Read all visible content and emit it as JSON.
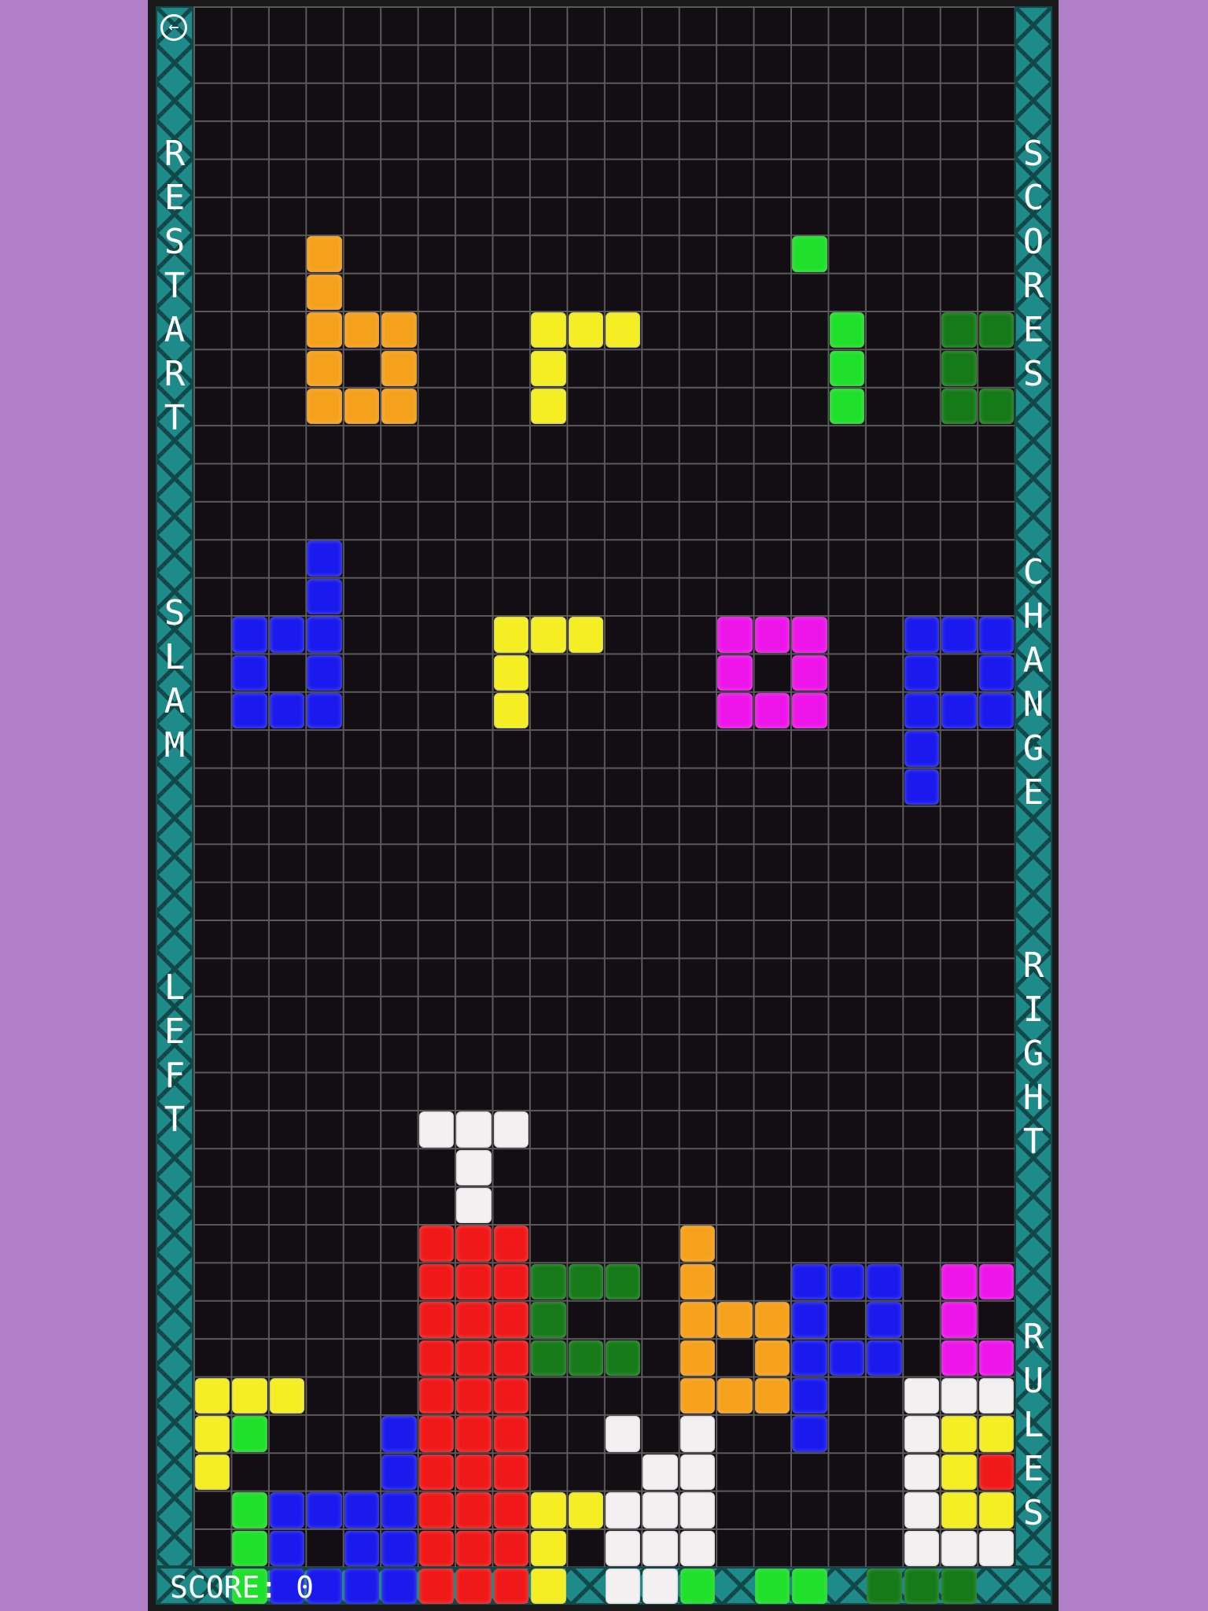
{
  "controls": {
    "restart": "RESTART",
    "slam": "SLAM",
    "left": "LEFT",
    "scores": "SCORES",
    "change": "CHANGE",
    "right": "RIGHT",
    "rules": "RULES",
    "back_icon": "arrow-left-circle-icon"
  },
  "score": {
    "label": "SCORE:",
    "value": "0"
  },
  "colors": {
    "O": "#f5a11c",
    "Y": "#f4ee22",
    "G": "#1fe02a",
    "D": "#157a17",
    "B": "#1a1aee",
    "M": "#ee15ea",
    "R": "#f01818",
    "W": "#f2f0f0"
  },
  "board": {
    "columns": 22,
    "rows": 41,
    "grid": [
      "......................",
      "......................",
      "......................",
      "......................",
      "......................",
      "......................",
      "...O............G.....",
      "...O..................",
      "...OOO...YYY.....G..DDD....",
      "...O.O...Y.......G..D.....",
      "...OOO...Y.......G..DDD....",
      "......................",
      "......................",
      "......................",
      "...B..................G.",
      "...B..................G.",
      ".BBB....YYY...MMM..BBB.G.",
      ".B.B....Y.....M.M..B.B....",
      ".BBB....Y.....MMM..BBB.G.",
      "...................B....",
      "...................B....",
      "......................",
      "......................",
      "......................",
      "......................",
      "......................",
      "......................",
      "......................",
      "......................",
      "......WWW.............",
      ".......W..............",
      ".......W..............",
      "......RRR....O........",
      "......RRRDDD.O..BBB.MMM",
      "......RRRD...OOOB.B.M.M",
      "......RRRDDD.O.OBBB.MMM",
      "YYY...RRR....OOOB..WWWWW",
      "YG...BRRR..W.W..B..WYYYW",
      "Y....BRRR...WW.....WYRYW",
      ".GBBBBRRRYYWWW.....WYYYW",
      ".GB.BBRRRY.WWW.....WWWWW",
      ".GBBBBRRRY.WWG.GG.DDD..."
    ]
  }
}
